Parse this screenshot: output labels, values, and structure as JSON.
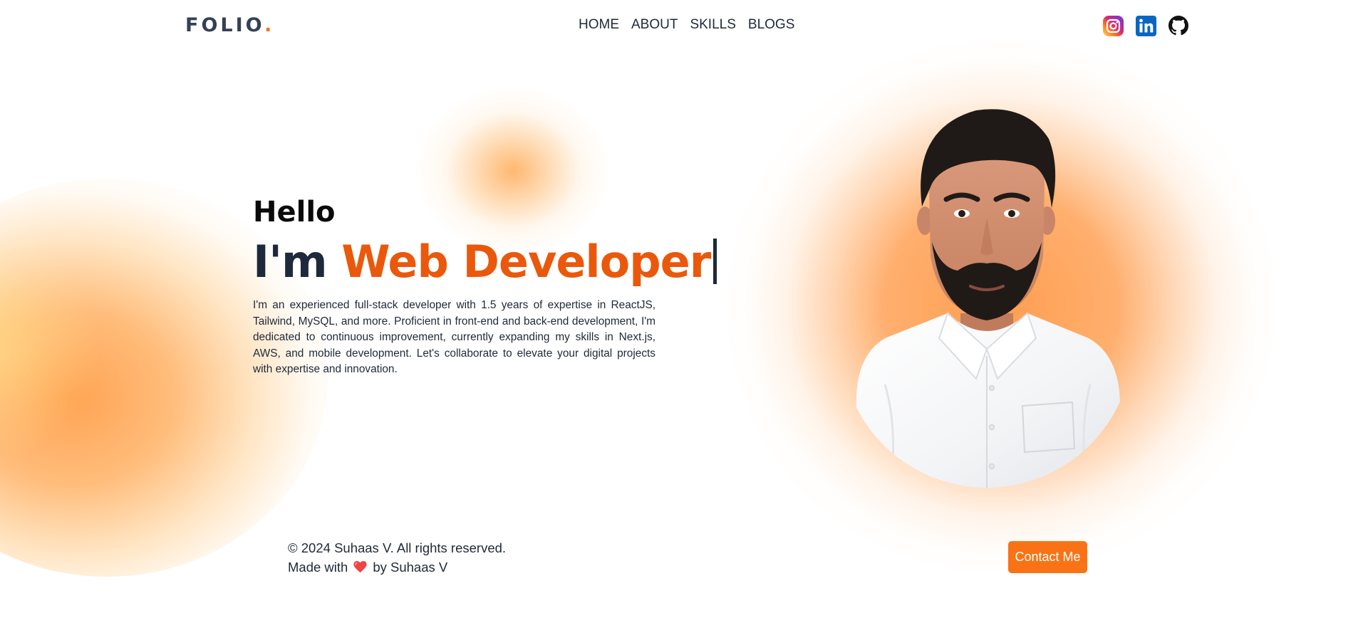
{
  "brand": {
    "logo_text": "FOLIO",
    "logo_dot": ".",
    "accent_color": "#f97316",
    "role_color": "#ea580c"
  },
  "nav": {
    "links": [
      {
        "label": "HOME"
      },
      {
        "label": "ABOUT"
      },
      {
        "label": "SKILLS"
      },
      {
        "label": "BLOGS"
      }
    ]
  },
  "socials": [
    {
      "icon": "instagram-icon"
    },
    {
      "icon": "linkedin-icon"
    },
    {
      "icon": "github-icon"
    }
  ],
  "hero": {
    "greeting": "Hello",
    "headline_prefix": "I'm ",
    "headline_role": "Web Developer",
    "bio": "I'm an experienced full-stack developer with 1.5 years of expertise in ReactJS, Tailwind, MySQL, and more. Proficient in front-end and back-end development, I'm dedicated to continuous improvement, currently expanding my skills in Next.js, AWS, and mobile development. Let's collaborate to elevate your digital projects with expertise and innovation."
  },
  "footer": {
    "copyright": "© 2024 Suhaas V. All rights reserved.",
    "made_with_prefix": "Made with",
    "made_with_suffix": "by Suhaas V",
    "heart_icon": "heart-icon"
  },
  "contact": {
    "button_label": "Contact Me"
  }
}
